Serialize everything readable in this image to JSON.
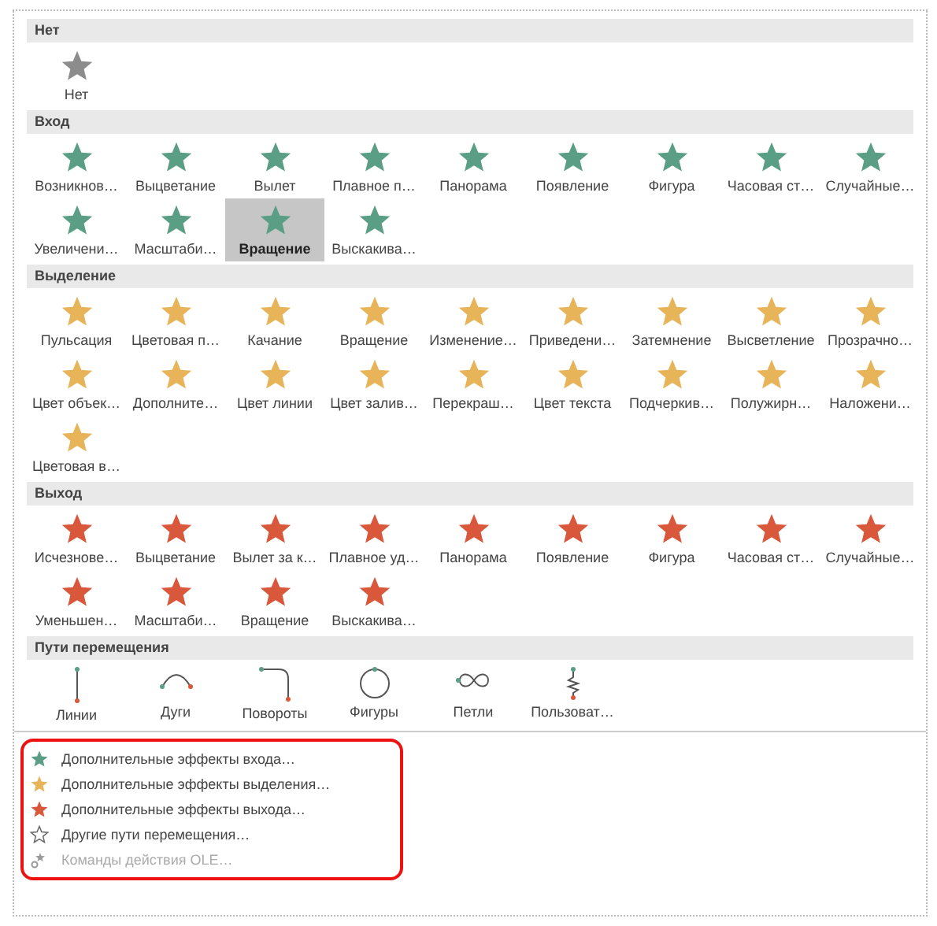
{
  "sections": [
    {
      "title": "Нет",
      "kind": "effects",
      "color": "#8c8c8c",
      "items": [
        {
          "label": "Нет",
          "selected": false
        }
      ]
    },
    {
      "title": "Вход",
      "kind": "effects",
      "color": "#5a9e86",
      "items": [
        {
          "label": "Возникнов…",
          "selected": false
        },
        {
          "label": "Выцветание",
          "selected": false
        },
        {
          "label": "Вылет",
          "selected": false
        },
        {
          "label": "Плавное п…",
          "selected": false
        },
        {
          "label": "Панорама",
          "selected": false
        },
        {
          "label": "Появление",
          "selected": false
        },
        {
          "label": "Фигура",
          "selected": false
        },
        {
          "label": "Часовая ст…",
          "selected": false
        },
        {
          "label": "Случайные…",
          "selected": false
        },
        {
          "label": "Увеличени…",
          "selected": false
        },
        {
          "label": "Масштаби…",
          "selected": false
        },
        {
          "label": "Вращение",
          "selected": true
        },
        {
          "label": "Выскакива…",
          "selected": false
        }
      ]
    },
    {
      "title": "Выделение",
      "kind": "effects",
      "color": "#e8b45a",
      "items": [
        {
          "label": "Пульсация",
          "selected": false
        },
        {
          "label": "Цветовая п…",
          "selected": false
        },
        {
          "label": "Качание",
          "selected": false
        },
        {
          "label": "Вращение",
          "selected": false
        },
        {
          "label": "Изменение…",
          "selected": false
        },
        {
          "label": "Приведени…",
          "selected": false
        },
        {
          "label": "Затемнение",
          "selected": false
        },
        {
          "label": "Высветление",
          "selected": false
        },
        {
          "label": "Прозрачно…",
          "selected": false
        },
        {
          "label": "Цвет объек…",
          "selected": false
        },
        {
          "label": "Дополните…",
          "selected": false
        },
        {
          "label": "Цвет линии",
          "selected": false
        },
        {
          "label": "Цвет залив…",
          "selected": false
        },
        {
          "label": "Перекраш…",
          "selected": false
        },
        {
          "label": "Цвет текста",
          "selected": false
        },
        {
          "label": "Подчеркив…",
          "selected": false
        },
        {
          "label": "Полужирн…",
          "selected": false
        },
        {
          "label": "Наложени…",
          "selected": false
        },
        {
          "label": "Цветовая в…",
          "selected": false
        }
      ]
    },
    {
      "title": "Выход",
      "kind": "effects",
      "color": "#d9573b",
      "items": [
        {
          "label": "Исчезнове…",
          "selected": false
        },
        {
          "label": "Выцветание",
          "selected": false
        },
        {
          "label": "Вылет за к…",
          "selected": false
        },
        {
          "label": "Плавное уд…",
          "selected": false
        },
        {
          "label": "Панорама",
          "selected": false
        },
        {
          "label": "Появление",
          "selected": false
        },
        {
          "label": "Фигура",
          "selected": false
        },
        {
          "label": "Часовая ст…",
          "selected": false
        },
        {
          "label": "Случайные…",
          "selected": false
        },
        {
          "label": "Уменьшен…",
          "selected": false
        },
        {
          "label": "Масштаби…",
          "selected": false
        },
        {
          "label": "Вращение",
          "selected": false
        },
        {
          "label": "Выскакива…",
          "selected": false
        }
      ]
    },
    {
      "title": "Пути перемещения",
      "kind": "paths",
      "items": [
        {
          "label": "Линии",
          "kind": "line",
          "selected": false
        },
        {
          "label": "Дуги",
          "kind": "arc",
          "selected": false
        },
        {
          "label": "Повороты",
          "kind": "turn",
          "selected": false
        },
        {
          "label": "Фигуры",
          "kind": "circle",
          "selected": false
        },
        {
          "label": "Петли",
          "kind": "loop",
          "selected": false
        },
        {
          "label": "Пользоват…",
          "kind": "custom",
          "selected": false
        }
      ]
    }
  ],
  "commands": [
    {
      "label": "Дополнительные эффекты входа…",
      "kind": "star",
      "color": "#5a9e86",
      "disabled": false
    },
    {
      "label": "Дополнительные эффекты выделения…",
      "kind": "star",
      "color": "#e8b45a",
      "disabled": false
    },
    {
      "label": "Дополнительные эффекты выхода…",
      "kind": "star",
      "color": "#d9573b",
      "disabled": false
    },
    {
      "label": "Другие пути перемещения…",
      "kind": "outline",
      "color": "#666666",
      "disabled": false
    },
    {
      "label": "Команды действия OLE…",
      "kind": "ole",
      "color": "#999999",
      "disabled": true
    }
  ]
}
